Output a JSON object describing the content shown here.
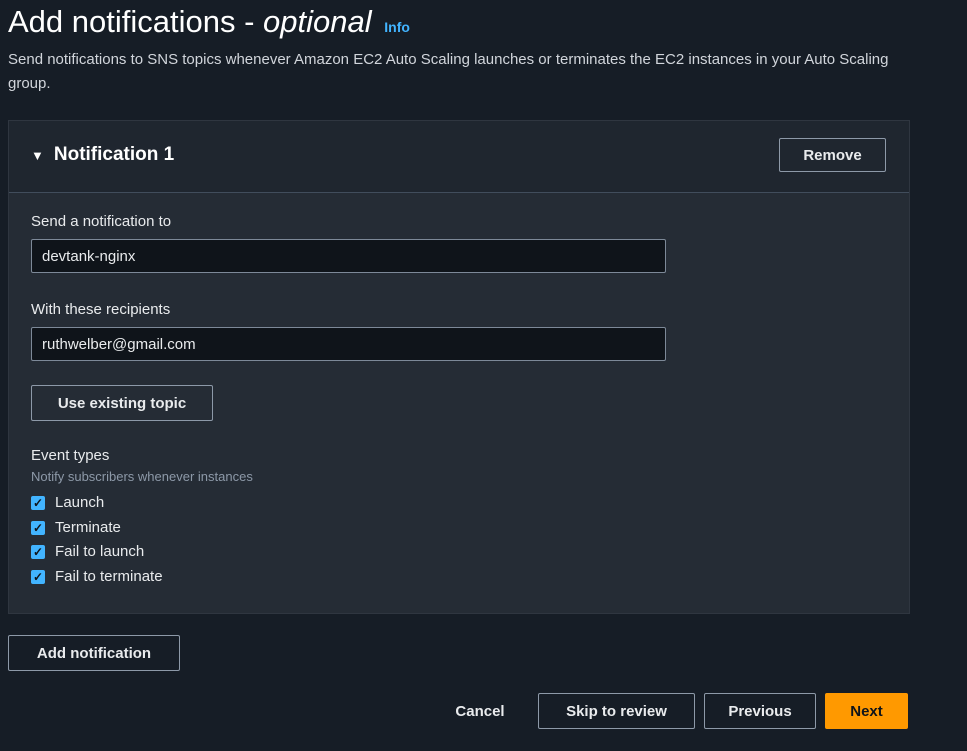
{
  "page": {
    "title": "Add notifications - ",
    "title_italic": "optional",
    "info": "Info",
    "description": "Send notifications to SNS topics whenever Amazon EC2 Auto Scaling launches or terminates the EC2 instances in your Auto Scaling group."
  },
  "notification": {
    "title": "Notification 1",
    "remove": "Remove",
    "send_label": "Send a notification to",
    "send_value": "devtank-nginx",
    "recipients_label": "With these recipients",
    "recipients_value": "ruthwelber@gmail.com",
    "use_existing": "Use existing topic",
    "event_types": "Event types",
    "event_hint": "Notify subscribers whenever instances",
    "events": [
      {
        "label": "Launch",
        "checked": true
      },
      {
        "label": "Terminate",
        "checked": true
      },
      {
        "label": "Fail to launch",
        "checked": true
      },
      {
        "label": "Fail to terminate",
        "checked": true
      }
    ]
  },
  "actions": {
    "add": "Add notification",
    "cancel": "Cancel",
    "skip": "Skip to review",
    "previous": "Previous",
    "next": "Next"
  },
  "colors": {
    "primary": "#ff9900",
    "checkbox": "#42b4ff"
  }
}
